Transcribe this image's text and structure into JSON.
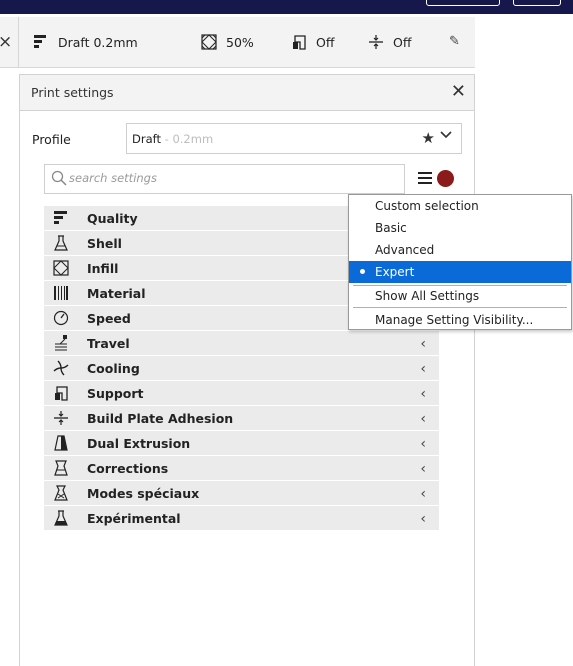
{
  "summary": {
    "profile": "Draft 0.2mm",
    "infill": "50%",
    "support": "Off",
    "adhesion": "Off"
  },
  "panel": {
    "title": "Print settings",
    "profile_label": "Profile",
    "profile_name": "Draft",
    "profile_suffix": " - 0.2mm",
    "search_placeholder": "search settings"
  },
  "categories": [
    {
      "label": "Quality",
      "icon": "quality-icon"
    },
    {
      "label": "Shell",
      "icon": "shell-icon"
    },
    {
      "label": "Infill",
      "icon": "infill-icon"
    },
    {
      "label": "Material",
      "icon": "material-icon"
    },
    {
      "label": "Speed",
      "icon": "speed-icon"
    },
    {
      "label": "Travel",
      "icon": "travel-icon"
    },
    {
      "label": "Cooling",
      "icon": "cooling-icon"
    },
    {
      "label": "Support",
      "icon": "support-icon"
    },
    {
      "label": "Build Plate Adhesion",
      "icon": "adhesion-icon"
    },
    {
      "label": "Dual Extrusion",
      "icon": "dual-extrusion-icon"
    },
    {
      "label": "Corrections",
      "icon": "corrections-icon"
    },
    {
      "label": "Modes spéciaux",
      "icon": "special-modes-icon"
    },
    {
      "label": "Expérimental",
      "icon": "experimental-icon"
    }
  ],
  "visibility_menu": {
    "items": [
      "Custom selection",
      "Basic",
      "Advanced",
      "Expert"
    ],
    "selected": "Expert",
    "show_all": "Show All Settings",
    "manage": "Manage Setting Visibility..."
  },
  "colors": {
    "accent": "#0a6ad8",
    "status_dot": "#8b1a1a",
    "top_bar": "#16174b"
  }
}
